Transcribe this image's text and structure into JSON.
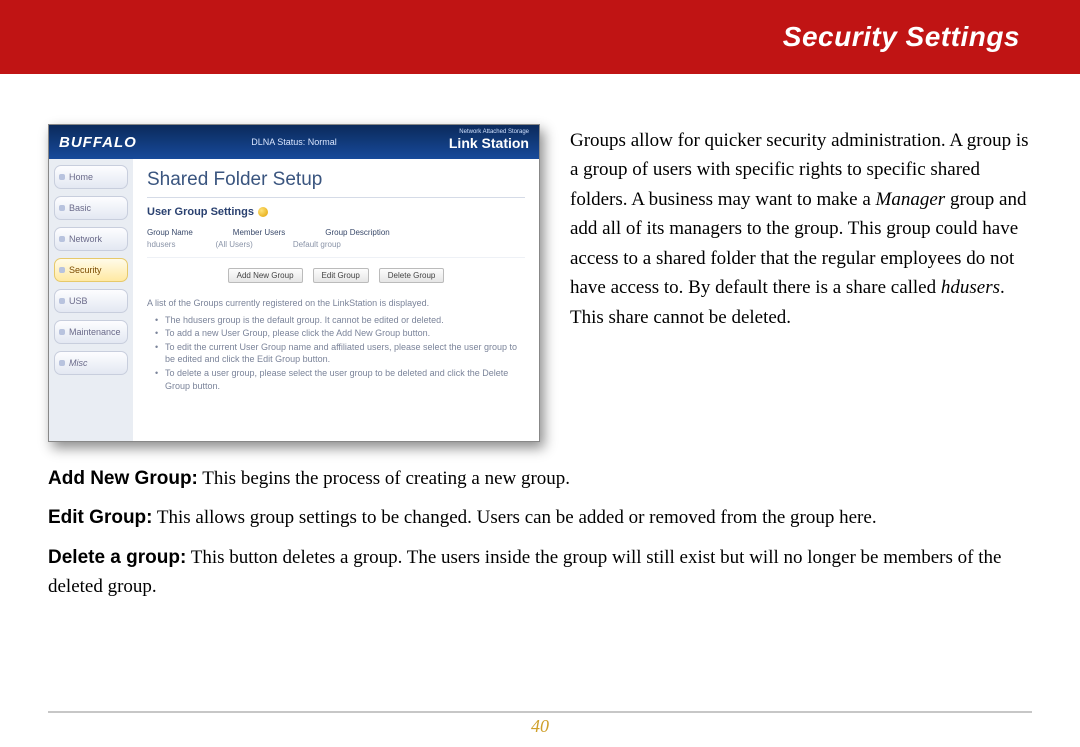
{
  "header": {
    "title": "Security Settings"
  },
  "figure": {
    "brand": "BUFFALO",
    "status": "DLNA Status: Normal",
    "product_small": "Network Attached Storage",
    "product": "Link Station",
    "sidebar": {
      "items": [
        "Home",
        "Basic",
        "Network",
        "Security",
        "USB",
        "Maintenance",
        "Misc"
      ]
    },
    "main": {
      "heading": "Shared Folder Setup",
      "sub": "User Group Settings",
      "cols": {
        "c1": "Group Name",
        "c2": "Member Users",
        "c3": "Group Description"
      },
      "row": {
        "c1": "hdusers",
        "c2": "(All Users)",
        "c3": "Default group"
      },
      "buttons": {
        "add": "Add New Group",
        "edit": "Edit Group",
        "del": "Delete Group"
      },
      "desc_lead": "A list of the Groups currently registered on the LinkStation is displayed.",
      "desc_b1": "The hdusers group is the default group. It cannot be edited or deleted.",
      "desc_b2": "To add a new User Group, please click the Add New Group button.",
      "desc_b3": "To edit the current User Group name and affiliated users, please select the user group to be edited and click the Edit Group button.",
      "desc_b4": "To delete a user group, please select the user group to be deleted and click the Delete Group button."
    }
  },
  "intro": {
    "p1a": "Groups allow for quicker security administration.  A group is a group of users with specific rights to specific shared folders.  A business may want to make a ",
    "p1_manager": "Manager",
    "p1b": " group and add all of its managers to the group.  This group could have access to a shared folder that the regular employees do not have access to.  By default there is a share called ",
    "p1_hdusers": "hdusers",
    "p1c": ".  This share cannot be deleted."
  },
  "defs": {
    "add_term": "Add New Group:",
    "add_text": "  This begins the process of creating a new group.",
    "edit_term": "Edit Group:",
    "edit_text": "  This allows group settings to be changed.  Users can be added or removed from the group here.",
    "del_term": "Delete a group:",
    "del_text": "  This button deletes a group.  The users inside the group will still exist but will no longer be members of the deleted group."
  },
  "page_number": "40"
}
